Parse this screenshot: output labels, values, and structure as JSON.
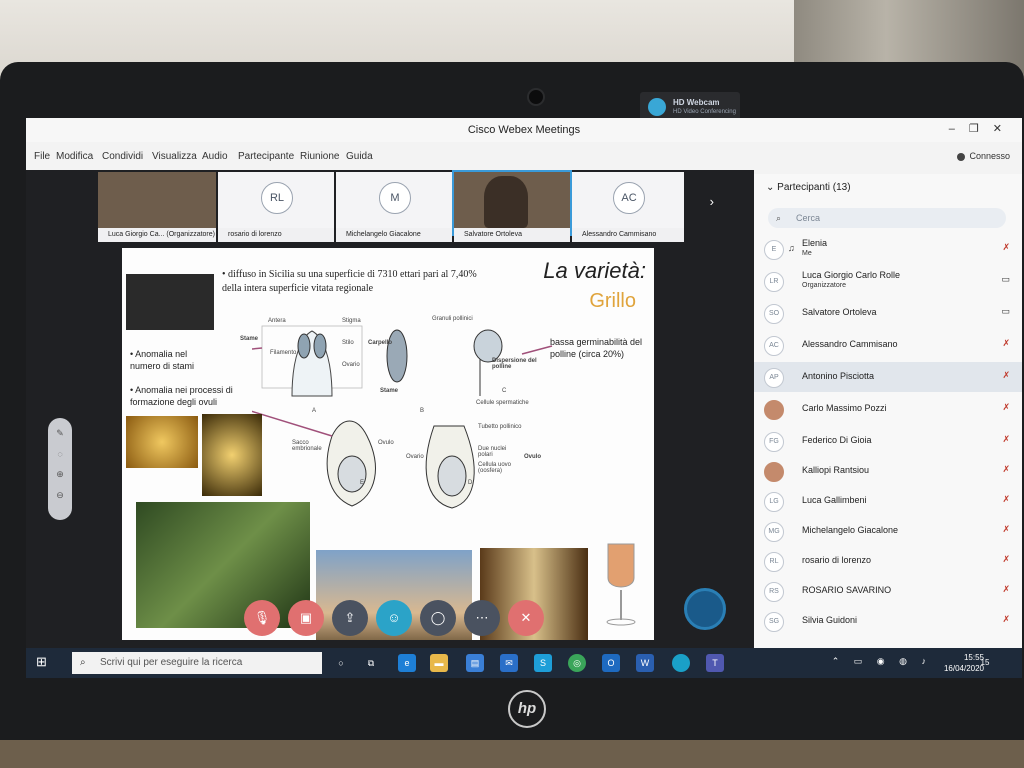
{
  "device": {
    "webcam_label": "HD Webcam",
    "webcam_sublabel": "HD Video Conferencing",
    "brand": "hp"
  },
  "window": {
    "title": "Cisco Webex Meetings",
    "controls": [
      "–",
      "❐",
      "✕"
    ]
  },
  "menu": {
    "items": [
      "File",
      "Modifica",
      "Condividi",
      "Visualizza",
      "Audio",
      "Partecipante",
      "Riunione",
      "Guida"
    ],
    "status": "Connesso"
  },
  "video_strip": {
    "tiles": [
      {
        "caption": "Luca Giorgio Ca... (Organizzatore)",
        "initials": ""
      },
      {
        "caption": "rosario di lorenzo",
        "initials": "RL"
      },
      {
        "caption": "Michelangelo Giacalone",
        "initials": "M"
      },
      {
        "caption": "Salvatore Ortoleva",
        "initials": ""
      },
      {
        "caption": "Alessandro Cammisano",
        "initials": "AC"
      }
    ],
    "next_icon": "chevron-right-icon"
  },
  "slide": {
    "title": "La varietà:",
    "subtitle": "Grillo",
    "bullet1": "• diffuso in Sicilia su una superficie di 7310 ettari pari al 7,40% della intera superficie vitata regionale",
    "bullet2": "• Anomalia nel numero di stami",
    "bullet3": "• Anomalia nei processi di formazione degli ovuli",
    "pollen_note": "bassa germinabilità del polline (circa 20%)",
    "diagram_labels": [
      "Antera",
      "Stigma",
      "Stame",
      "Stilo",
      "Filamento",
      "Ovario",
      "Carpello",
      "Granuli pollinici",
      "Dispersione del polline",
      "Stame",
      "Cellule spermatiche",
      "Tubetto pollinico",
      "Sacco embrionale",
      "Ovulo",
      "Ovario",
      "Due nuclei polari",
      "Cellula uovo (oosfera)",
      "Ovulo",
      "A",
      "B",
      "C",
      "D",
      "E"
    ]
  },
  "controls": {
    "buttons": [
      "mute-icon",
      "stop-video-icon",
      "share-icon",
      "participants-icon",
      "chat-icon",
      "more-icon",
      "end-call-icon"
    ]
  },
  "participants": {
    "title": "Partecipanti (13)",
    "search_placeholder": "Cerca",
    "list": [
      {
        "initials": "E",
        "name": "Elenia",
        "role": "Me"
      },
      {
        "initials": "LR",
        "name": "Luca Giorgio Carlo Rolle",
        "role": "Organizzatore"
      },
      {
        "initials": "SO",
        "name": "Salvatore Ortoleva",
        "role": ""
      },
      {
        "initials": "AC",
        "name": "Alessandro Cammisano",
        "role": ""
      },
      {
        "initials": "AP",
        "name": "Antonino Pisciotta",
        "role": ""
      },
      {
        "initials": "",
        "name": "Carlo Massimo Pozzi",
        "role": ""
      },
      {
        "initials": "FG",
        "name": "Federico Di Gioia",
        "role": ""
      },
      {
        "initials": "",
        "name": "Kalliopi Rantsiou",
        "role": ""
      },
      {
        "initials": "LG",
        "name": "Luca Gallimbeni",
        "role": ""
      },
      {
        "initials": "MG",
        "name": "Michelangelo Giacalone",
        "role": ""
      },
      {
        "initials": "RL",
        "name": "rosario di lorenzo",
        "role": ""
      },
      {
        "initials": "RS",
        "name": "ROSARIO SAVARINO",
        "role": ""
      },
      {
        "initials": "SG",
        "name": "Silvia Guidoni",
        "role": ""
      }
    ]
  },
  "taskbar": {
    "search_placeholder": "Scrivi qui per eseguire la ricerca",
    "time": "15:55",
    "date": "16/04/2020",
    "notification_count": "15"
  }
}
